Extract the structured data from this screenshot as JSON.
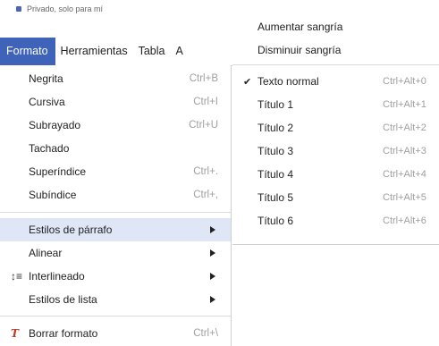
{
  "doc": {
    "privacy_text": "Privado, solo para mí"
  },
  "menubar": {
    "items": [
      "Formato",
      "Herramientas",
      "Tabla",
      "A"
    ]
  },
  "format_menu": {
    "items": [
      {
        "label": "Negrita",
        "shortcut": "Ctrl+B"
      },
      {
        "label": "Cursiva",
        "shortcut": "Ctrl+I"
      },
      {
        "label": "Subrayado",
        "shortcut": "Ctrl+U"
      },
      {
        "label": "Tachado",
        "shortcut": ""
      },
      {
        "label": "Superíndice",
        "shortcut": "Ctrl+."
      },
      {
        "label": "Subíndice",
        "shortcut": "Ctrl+,"
      },
      {
        "label": "Estilos de párrafo",
        "shortcut": ""
      },
      {
        "label": "Alinear",
        "shortcut": ""
      },
      {
        "label": "Interlineado",
        "shortcut": ""
      },
      {
        "label": "Estilos de lista",
        "shortcut": ""
      },
      {
        "label": "Borrar formato",
        "shortcut": "Ctrl+\\"
      }
    ]
  },
  "paragraph_submenu": {
    "indent_items": [
      "Aumentar sangría",
      "Disminuir sangría"
    ],
    "styles": [
      {
        "label": "Texto normal",
        "shortcut": "Ctrl+Alt+0",
        "checked": true
      },
      {
        "label": "Título 1",
        "shortcut": "Ctrl+Alt+1"
      },
      {
        "label": "Título 2",
        "shortcut": "Ctrl+Alt+2"
      },
      {
        "label": "Título 3",
        "shortcut": "Ctrl+Alt+3"
      },
      {
        "label": "Título 4",
        "shortcut": "Ctrl+Alt+4"
      },
      {
        "label": "Título 5",
        "shortcut": "Ctrl+Alt+5"
      },
      {
        "label": "Título 6",
        "shortcut": "Ctrl+Alt+6"
      }
    ],
    "check_mark": "✔"
  },
  "icons": {
    "interlineado": "line-spacing-icon",
    "borrar": "clear-formatting-icon"
  },
  "colors": {
    "accent": "#3f63b8",
    "highlight": "#dfe7f6"
  }
}
